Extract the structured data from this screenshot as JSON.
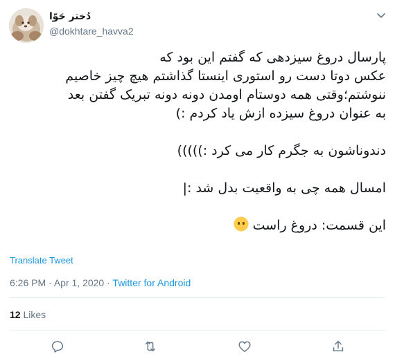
{
  "tweet": {
    "display_name": "دُختر حَوّا",
    "username": "@dokhtare_havva2",
    "text": {
      "p1": "پارسال دروغ سیزدهی که گفتم این بود که\nعکس دوتا دست رو استوری اینستا گذاشتم هیچ چیز خاصیم\nننوشتم؛وقتی همه دوستام اومدن دونه دونه تبریک گفتن بعد\nبه عنوان دروغ سیزده ازش یاد کردم :)",
      "p2": "دندوناشون به جگرم کار می کرد :)))))",
      "p3": "امسال همه چی به واقعیت بدل شد :|",
      "p4": "این قسمت: دروغ راست"
    },
    "translate_label": "Translate Tweet",
    "time": "6:26 PM",
    "date": "Apr 1, 2020",
    "separator": "·",
    "source": "Twitter for Android",
    "likes_count": "12",
    "likes_label": "Likes"
  },
  "icons": {
    "caret": "chevron-down-icon",
    "reply": "reply-icon",
    "retweet": "retweet-icon",
    "like": "heart-icon",
    "share": "share-icon",
    "emoji": "neutral-face-emoji"
  },
  "colors": {
    "text": "#14171a",
    "secondary": "#657786",
    "link": "#1b95e0",
    "divider": "#e6ecf0",
    "emoji": "#ffcc4d"
  }
}
